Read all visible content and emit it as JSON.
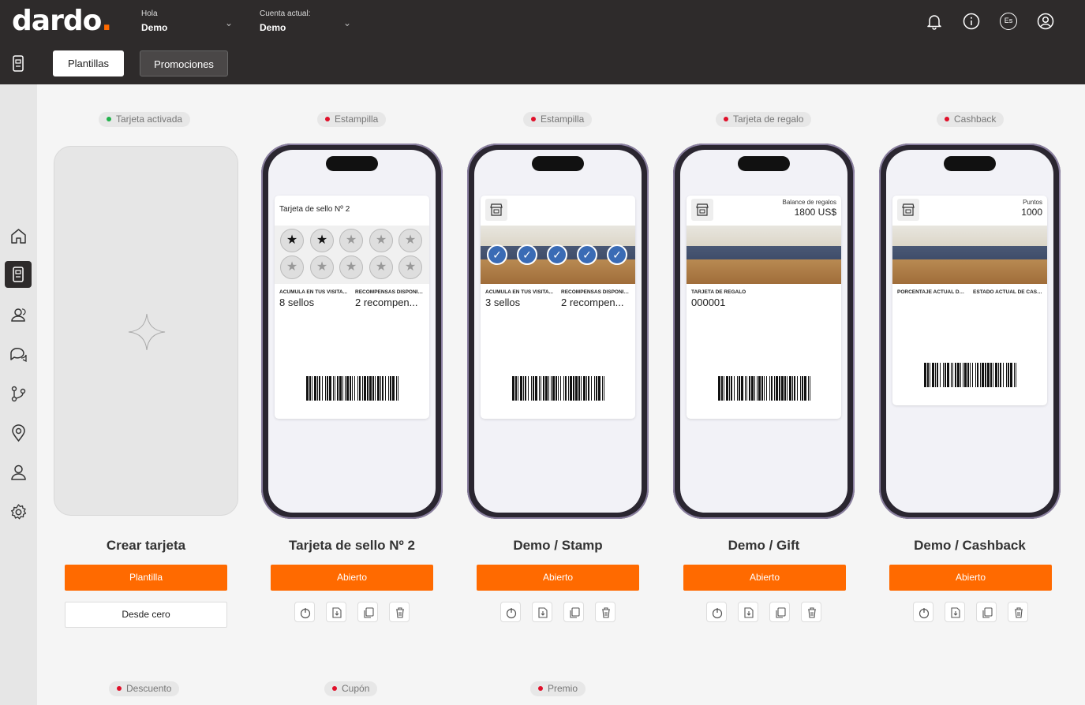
{
  "header": {
    "logo_text": "dard",
    "logo_o": "o",
    "logo_dot": ".",
    "hello_label": "Hola",
    "hello_user": "Demo",
    "account_label": "Cuenta actual:",
    "account_value": "Demo",
    "language_badge": "Es",
    "icons": [
      "bell-icon",
      "info-icon",
      "language-icon",
      "user-icon"
    ]
  },
  "tabs": {
    "templates": "Plantillas",
    "promotions": "Promociones"
  },
  "sidebar": {
    "items": [
      "home-icon",
      "wallet-icon",
      "users-icon",
      "chat-icon",
      "flow-icon",
      "location-icon",
      "user-icon",
      "settings-icon"
    ],
    "active": "wallet-icon"
  },
  "colors": {
    "accent": "#ff6a00",
    "dot_green": "#22b24c",
    "dot_red": "#e0102a",
    "topbar": "#2e2b2b"
  },
  "cards": [
    {
      "badge": "Tarjeta activada",
      "dot": "green",
      "name": "Crear tarjeta",
      "primary": "Plantilla",
      "secondary": "Desde cero"
    },
    {
      "badge": "Estampilla",
      "dot": "red",
      "name": "Tarjeta de sello Nº 2",
      "primary": "Abierto",
      "pass": {
        "title": "Tarjeta de sello Nº 2",
        "stamps_filled": 2,
        "stamps_total": 10,
        "f1_label": "ACUMULA EN TUS VISITA...",
        "f1_value": "8 sellos",
        "f2_label": "RECOMPENSAS DISPONIB...",
        "f2_value": "2 recompen..."
      }
    },
    {
      "badge": "Estampilla",
      "dot": "red",
      "name": "Demo / Stamp",
      "primary": "Abierto",
      "pass": {
        "checks": 5,
        "f1_label": "ACUMULA EN TUS VISITA...",
        "f1_value": "3 sellos",
        "f2_label": "RECOMPENSAS DISPONIB...",
        "f2_value": "2 recompen..."
      }
    },
    {
      "badge": "Tarjeta de regalo",
      "dot": "red",
      "name": "Demo / Gift",
      "primary": "Abierto",
      "pass": {
        "hdr_label": "Balance de regalos",
        "hdr_value": "1800 US$",
        "f1_label": "TARJETA DE REGALO",
        "f1_value": "000001"
      }
    },
    {
      "badge": "Cashback",
      "dot": "red",
      "name": "Demo / Cashback",
      "primary": "Abierto",
      "pass": {
        "hdr_label": "Puntos",
        "hdr_value": "1000",
        "f1_label": "PORCENTAJE ACTUAL DE ...",
        "f2_label": "ESTADO ACTUAL DE CASH..."
      }
    }
  ],
  "bottom_badges": [
    "Descuento",
    "Cupón",
    "Premio"
  ],
  "action_icons": [
    "power-icon",
    "download-icon",
    "duplicate-icon",
    "trash-icon"
  ]
}
